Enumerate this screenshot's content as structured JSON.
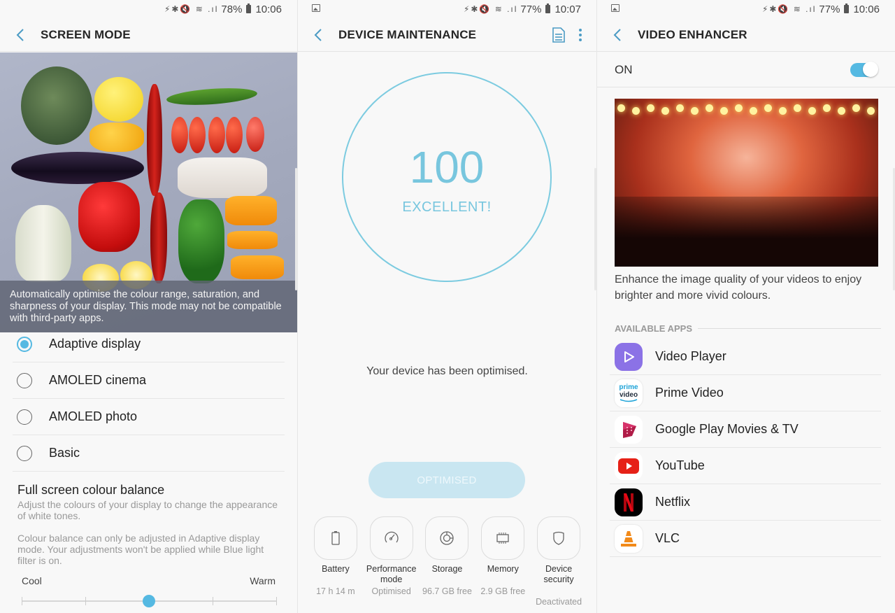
{
  "screen_mode": {
    "status": {
      "battery": "78%",
      "time": "10:06"
    },
    "title": "SCREEN MODE",
    "hero_caption": "Automatically optimise the colour range, saturation, and sharpness of your display. This mode may not be compatible with third-party apps.",
    "options": [
      {
        "label": "Adaptive display",
        "selected": true
      },
      {
        "label": "AMOLED cinema",
        "selected": false
      },
      {
        "label": "AMOLED photo",
        "selected": false
      },
      {
        "label": "Basic",
        "selected": false
      }
    ],
    "colour_balance": {
      "title": "Full screen colour balance",
      "description": "Adjust the colours of your display to change the appearance of white tones.",
      "note": "Colour balance can only be adjusted in Adaptive display mode. Your adjustments won't be applied while Blue light filter is on.",
      "min_label": "Cool",
      "max_label": "Warm",
      "value_fraction": 0.5,
      "steps": 4
    }
  },
  "device_maintenance": {
    "status": {
      "battery": "77%",
      "time": "10:07"
    },
    "title": "DEVICE MAINTENANCE",
    "score": "100",
    "score_label": "EXCELLENT!",
    "message": "Your device has been optimised.",
    "button_label": "OPTIMISED",
    "tiles": [
      {
        "label": "Battery",
        "value": "17 h 14 m",
        "icon": "battery-icon"
      },
      {
        "label": "Performance mode",
        "value": "Optimised",
        "icon": "speedometer-icon"
      },
      {
        "label": "Storage",
        "value": "96.7 GB free",
        "icon": "storage-icon"
      },
      {
        "label": "Memory",
        "value": "2.9 GB free",
        "icon": "memory-chip-icon"
      },
      {
        "label": "Device security",
        "value": "Deactivated",
        "icon": "shield-icon"
      }
    ]
  },
  "video_enhancer": {
    "status": {
      "battery": "77%",
      "time": "10:06"
    },
    "title": "VIDEO ENHANCER",
    "toggle_label": "ON",
    "toggle_on": true,
    "description": "Enhance the image quality of your videos to enjoy brighter and more vivid colours.",
    "section_title": "AVAILABLE APPS",
    "apps": [
      {
        "label": "Video Player"
      },
      {
        "label": "Prime Video"
      },
      {
        "label": "Google Play Movies & TV"
      },
      {
        "label": "YouTube"
      },
      {
        "label": "Netflix"
      },
      {
        "label": "VLC"
      }
    ]
  },
  "colors": {
    "accent": "#55b9e2",
    "score": "#78c6de",
    "button_disabled": "#c9e6f1"
  }
}
